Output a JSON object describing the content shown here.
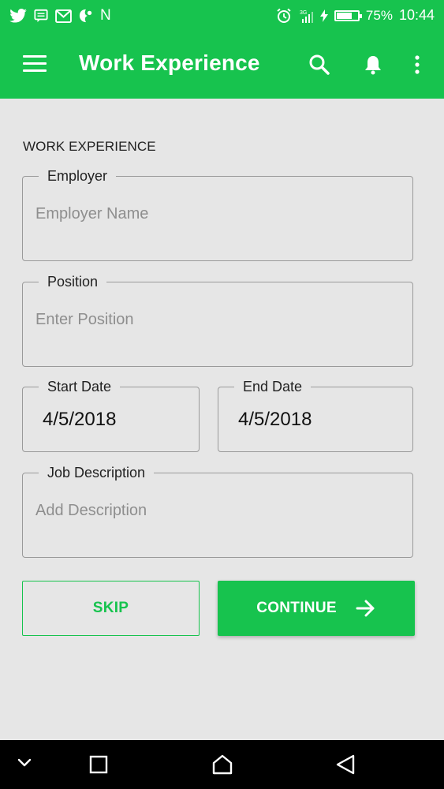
{
  "status_bar": {
    "left_icons": [
      "twitter-icon",
      "message-icon",
      "gmail-icon",
      "dragon-app-icon"
    ],
    "n_label": "N",
    "right_icons": [
      "alarm-icon",
      "signal-3g-icon",
      "charging-icon",
      "battery-icon"
    ],
    "battery_percent": "75%",
    "battery_level": 0.75,
    "time": "10:44"
  },
  "app_bar": {
    "title": "Work Experience",
    "icons": [
      "menu-icon",
      "search-icon",
      "bell-icon",
      "more-vert-icon"
    ]
  },
  "form": {
    "section_label": "WORK EXPERIENCE",
    "employer": {
      "label": "Employer",
      "placeholder": "Employer Name"
    },
    "position": {
      "label": "Position",
      "placeholder": "Enter Position"
    },
    "start_date": {
      "label": "Start Date",
      "value": "4/5/2018"
    },
    "end_date": {
      "label": "End Date",
      "value": "4/5/2018"
    },
    "job_description": {
      "label": "Job Description",
      "placeholder": "Add Description"
    }
  },
  "buttons": {
    "skip": "SKIP",
    "continue": "CONTINUE"
  },
  "colors": {
    "accent": "#17c34e",
    "background": "#e6e6e6",
    "nav_bar": "#000000"
  },
  "nav_bar": {
    "icons": [
      "collapse-chevron-icon",
      "recents-square-icon",
      "home-icon",
      "back-triangle-icon"
    ]
  }
}
